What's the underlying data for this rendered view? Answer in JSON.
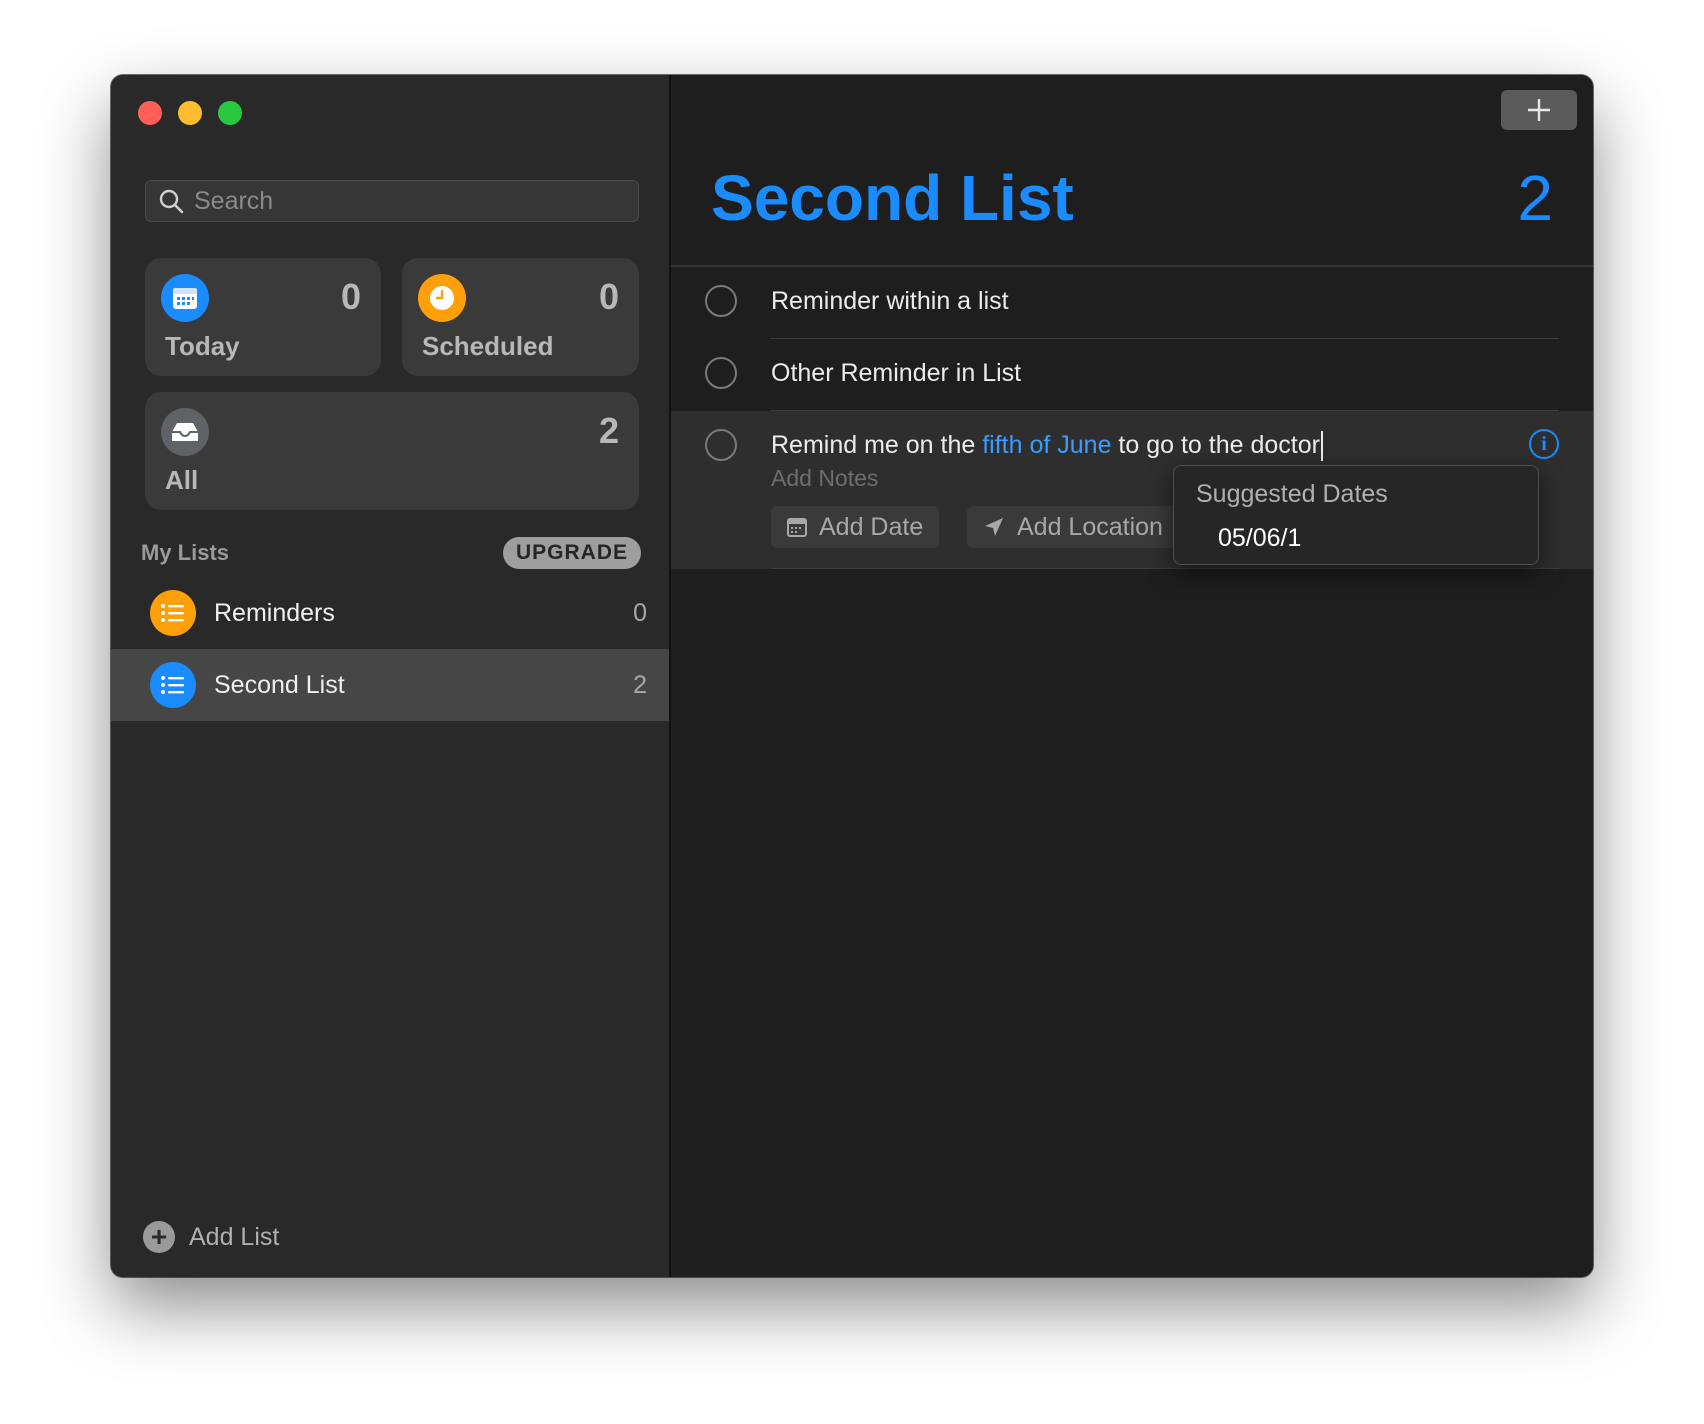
{
  "window": {
    "traffic_lights": [
      "close",
      "minimize",
      "zoom"
    ]
  },
  "sidebar": {
    "search": {
      "placeholder": "Search",
      "value": ""
    },
    "smart_lists": [
      {
        "label": "Today",
        "count": "0",
        "icon": "calendar-icon",
        "color": "#1a8cff"
      },
      {
        "label": "Scheduled",
        "count": "0",
        "icon": "clock-icon",
        "color": "#ff9f0a"
      },
      {
        "label": "All",
        "count": "2",
        "icon": "tray-icon",
        "color": "#8e8e93"
      }
    ],
    "my_lists_title": "My Lists",
    "upgrade_label": "UPGRADE",
    "lists": [
      {
        "name": "Reminders",
        "count": "0",
        "color": "#ff9f0a",
        "icon": "list-bullet-icon",
        "selected": false
      },
      {
        "name": "Second List",
        "count": "2",
        "color": "#1a8cff",
        "icon": "list-bullet-icon",
        "selected": true
      }
    ],
    "add_list_label": "Add List"
  },
  "main": {
    "title": "Second List",
    "count": "2",
    "accent": "#1a8cff",
    "tasks": [
      {
        "text": "Reminder within a list"
      },
      {
        "text": "Other Reminder in List"
      }
    ],
    "editing_task": {
      "text_before": "Remind me on the ",
      "highlight": "fifth of June",
      "text_after": " to go to the doctor",
      "notes_placeholder": "Add Notes",
      "add_date_label": "Add Date",
      "add_location_label": "Add Location"
    },
    "suggestions": {
      "title": "Suggested Dates",
      "items": [
        "05/06/1"
      ]
    }
  }
}
